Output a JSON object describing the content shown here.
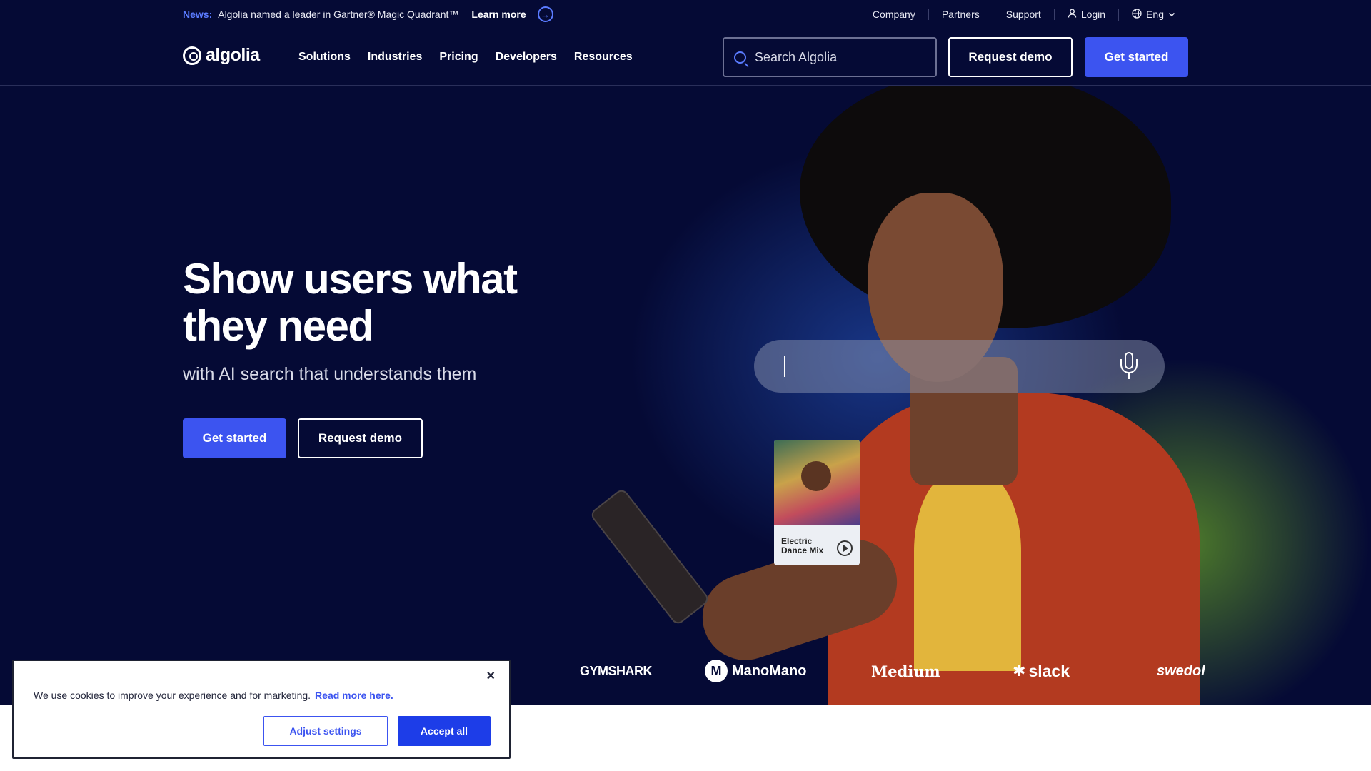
{
  "newsbar": {
    "tag": "News:",
    "text": "Algolia named a leader in Gartner® Magic Quadrant™",
    "learn_more": "Learn more",
    "links": {
      "company": "Company",
      "partners": "Partners",
      "support": "Support",
      "login": "Login",
      "language": "Eng"
    }
  },
  "nav": {
    "logo_text": "algolia",
    "items": [
      "Solutions",
      "Industries",
      "Pricing",
      "Developers",
      "Resources"
    ],
    "search_placeholder": "Search Algolia",
    "request_demo": "Request demo",
    "get_started": "Get started"
  },
  "hero": {
    "title": "Show users what they need",
    "subtitle": "with AI search that understands them",
    "get_started": "Get started",
    "request_demo": "Request demo",
    "music_card": "Electric Dance Mix"
  },
  "logos": {
    "gymshark": "GYMSHARK",
    "manomano": "ManoMano",
    "medium": "Medium",
    "slack": "slack",
    "swedol": "swedol"
  },
  "cookie": {
    "text": "We use cookies to improve your experience and for marketing.",
    "link": "Read more here.",
    "adjust": "Adjust settings",
    "accept": "Accept all",
    "close": "×"
  },
  "colors": {
    "background": "#050a35",
    "primary": "#3c54f0",
    "accent": "#5a7bff",
    "jacket": "#b33a20"
  }
}
